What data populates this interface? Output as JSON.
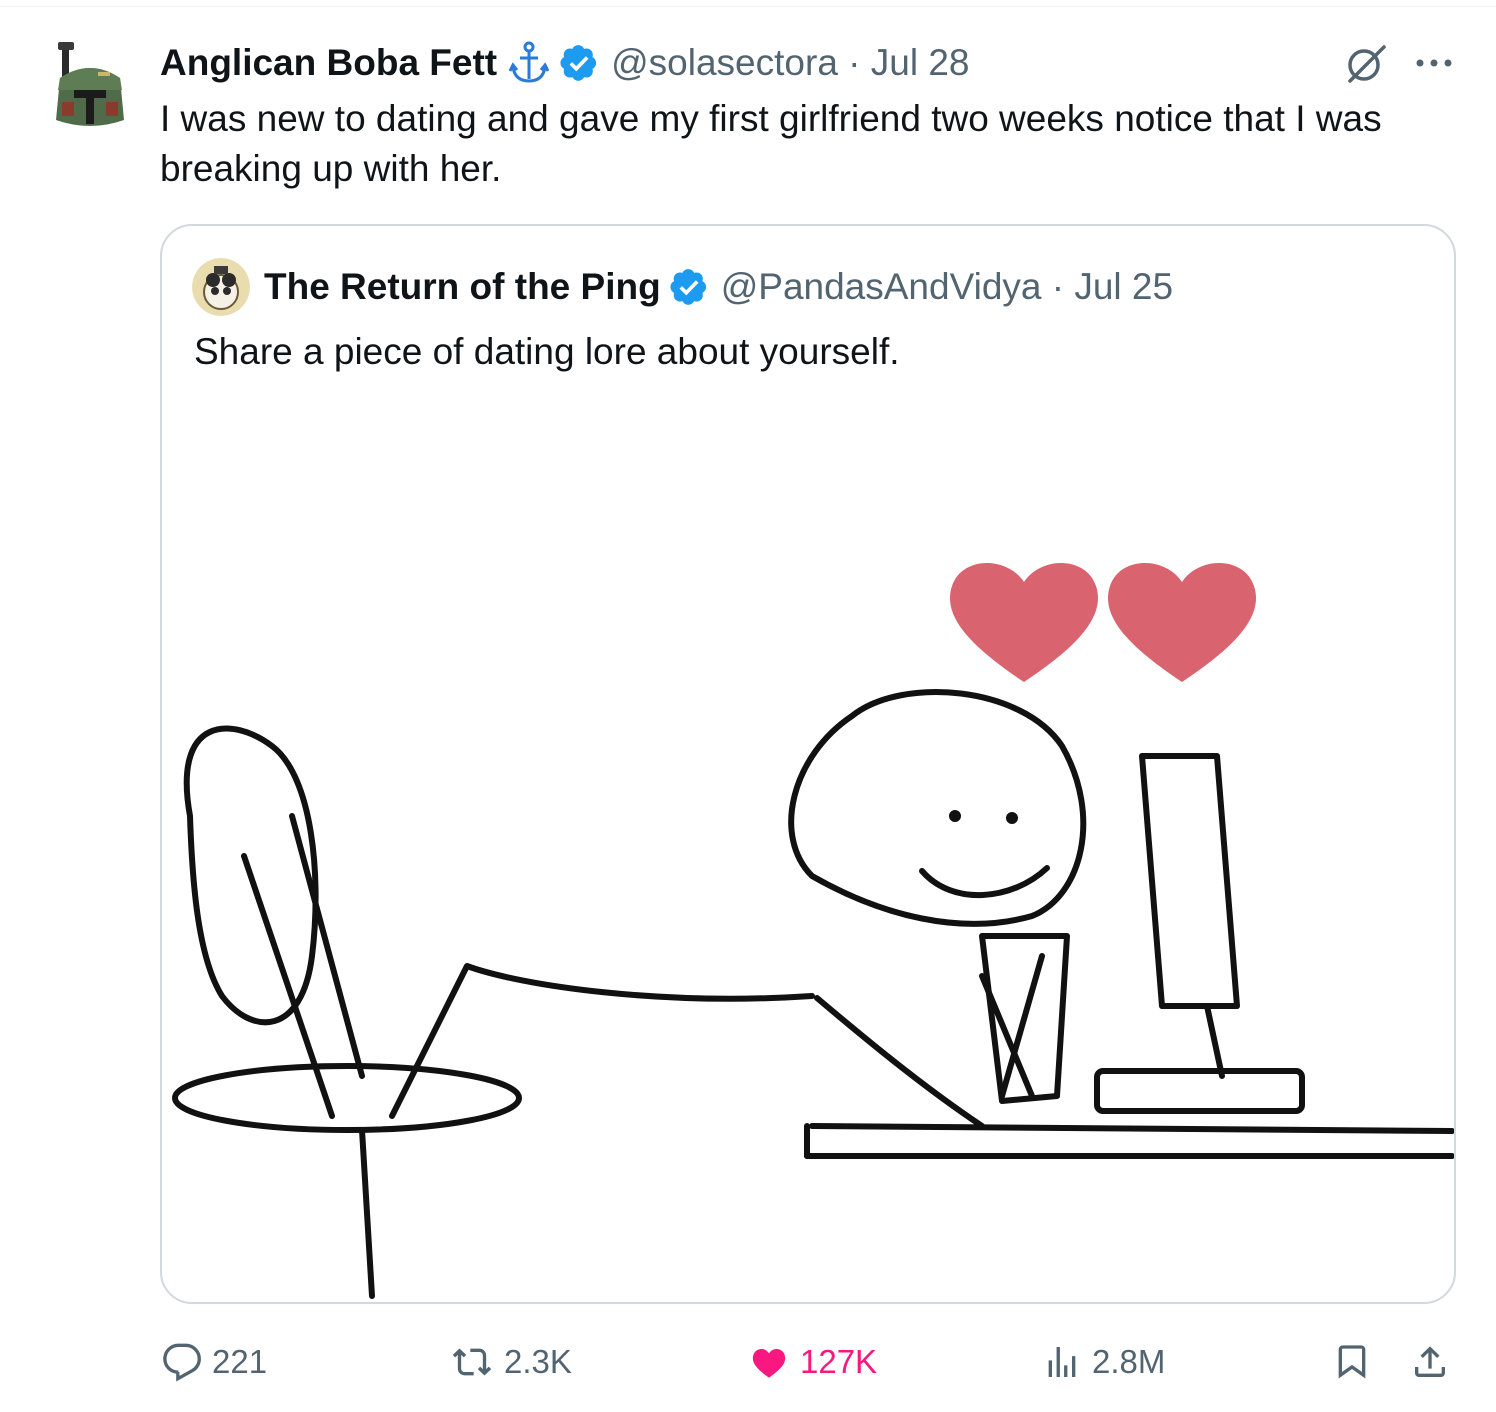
{
  "tweet": {
    "author_name": "Anglican Boba Fett",
    "handle_date": "@solasectora · Jul 28",
    "text": "I was new to dating and gave my first girlfriend two weeks notice that I was breaking up with her.",
    "icons": {
      "avatar": "boba-fett-helmet-avatar",
      "anchor": "anchor-icon",
      "verified": "verified-badge-icon",
      "grok": "grok-icon",
      "more": "more-icon"
    }
  },
  "quote": {
    "author_name": "The Return of the Ping",
    "handle_date": "@PandasAndVidya · Jul 25",
    "text": "Share a piece of dating lore about yourself.",
    "image": "stick-figure-meme-image"
  },
  "actions": {
    "replies": "221",
    "reposts": "2.3K",
    "likes": "127K",
    "views": "2.8M"
  },
  "colors": {
    "text": "#0f1419",
    "secondary": "#536471",
    "verified": "#1d9bf0",
    "like": "#f91880",
    "border": "#cfd9de",
    "heart": "#d9636f"
  }
}
